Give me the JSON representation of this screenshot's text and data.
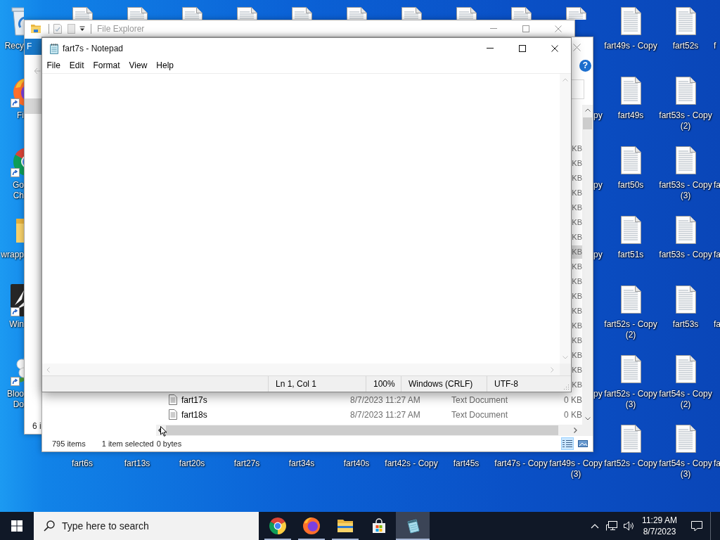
{
  "desktop": {
    "left_column": [
      {
        "kind": "recycle-bin",
        "shortcut": false,
        "label": "Recy"
      },
      {
        "kind": "firefox",
        "shortcut": true,
        "label": "Fi"
      },
      {
        "kind": "chrome",
        "shortcut": true,
        "label": "Go Ch"
      },
      {
        "kind": "folder",
        "shortcut": false,
        "label": "wrapp"
      },
      {
        "kind": "dark-app",
        "shortcut": true,
        "label": "Win"
      },
      {
        "kind": "flower",
        "shortcut": true,
        "label": "Bloo Do"
      }
    ],
    "top_row": [
      {
        "kind": "text-file"
      },
      {
        "kind": "text-file"
      },
      {
        "kind": "text-file"
      },
      {
        "kind": "text-file"
      },
      {
        "kind": "text-file"
      },
      {
        "kind": "text-file"
      },
      {
        "kind": "text-file"
      },
      {
        "kind": "text-file"
      },
      {
        "kind": "text-file"
      },
      {
        "kind": "text-file"
      }
    ],
    "bottom_row": [
      "fart6s",
      "fart13s",
      "fart20s",
      "fart27s",
      "fart34s",
      "fart40s",
      "fart42s - Copy",
      "fart45s",
      "fart47s - Copy",
      "fart49s - Copy (3)"
    ],
    "right_rows": [
      {
        "columns": [
          {
            "kind": "text-file",
            "label": "fart49s - Copy"
          },
          {
            "kind": "text-file",
            "label": "fart52s"
          }
        ],
        "partial_right": "f"
      },
      {
        "partial_left": "py",
        "columns": [
          {
            "kind": "text-file",
            "label": "fart49s"
          },
          {
            "kind": "text-file",
            "label": "fart53s - Copy (2)"
          }
        ]
      },
      {
        "partial_left": "py",
        "columns": [
          {
            "kind": "text-file",
            "label": "fart50s"
          },
          {
            "kind": "text-file",
            "label": "fart53s - Copy (3)"
          }
        ],
        "partial_right": "fa"
      },
      {
        "partial_left": "py",
        "columns": [
          {
            "kind": "text-file",
            "label": "fart51s"
          },
          {
            "kind": "text-file",
            "label": "fart53s - Copy"
          }
        ],
        "partial_right": "fa"
      },
      {
        "columns": [
          {
            "kind": "text-file",
            "label": "fart52s - Copy (2)"
          },
          {
            "kind": "text-file",
            "label": "fart53s"
          }
        ],
        "partial_right": "fa"
      },
      {
        "partial_left": "py",
        "columns": [
          {
            "kind": "text-file",
            "label": "fart52s - Copy (3)"
          },
          {
            "kind": "text-file",
            "label": "fart54s - Copy (2)"
          }
        ]
      },
      {
        "columns": [
          {
            "kind": "text-file",
            "label": "fart52s - Copy"
          },
          {
            "kind": "text-file",
            "label": "fart54s - Copy (3)"
          }
        ],
        "partial_right": "fa"
      }
    ]
  },
  "explorer_behind": {
    "title": "File Explorer",
    "active": false,
    "file_tab": "F",
    "nav_items": [
      {
        "selected": true
      }
    ],
    "status": "6 i"
  },
  "explorer": {
    "active": false,
    "help": "?",
    "rows": [
      {
        "size": "KB",
        "selected": false
      },
      {
        "size": "KB",
        "selected": false
      },
      {
        "size": "KB",
        "selected": false
      },
      {
        "size": "KB",
        "selected": false
      },
      {
        "size": "KB",
        "selected": false
      },
      {
        "size": "KB",
        "selected": false
      },
      {
        "size": "KB",
        "selected": false
      },
      {
        "size": "KB",
        "selected": true
      },
      {
        "size": "KB",
        "selected": false
      },
      {
        "size": "KB",
        "selected": false
      },
      {
        "size": "KB",
        "selected": false
      },
      {
        "size": "KB",
        "selected": false
      },
      {
        "size": "KB",
        "selected": false
      },
      {
        "size": "KB",
        "selected": false
      },
      {
        "size": "KB",
        "selected": false
      },
      {
        "size": "KB",
        "selected": false
      },
      {
        "size": "KB",
        "selected": false
      },
      {
        "name": "fart17s",
        "date": "8/7/2023 11:27 AM",
        "type": "Text Document",
        "size": "0 KB",
        "selected": false
      },
      {
        "name": "fart18s",
        "date": "8/7/2023 11:27 AM",
        "type": "Text Document",
        "size": "0 KB",
        "selected": false
      }
    ],
    "status": {
      "items": "795 items",
      "selection": "1 item selected",
      "size": "0 bytes"
    },
    "views": [
      {
        "kind": "details",
        "selected": true
      },
      {
        "kind": "large-icons",
        "selected": false
      }
    ]
  },
  "notepad": {
    "title": "fart7s - Notepad",
    "active": true,
    "menu": [
      "File",
      "Edit",
      "Format",
      "View",
      "Help"
    ],
    "status": [
      "Ln 1, Col 1",
      "100%",
      "Windows (CRLF)",
      "UTF-8"
    ]
  },
  "taskbar": {
    "search": {
      "placeholder": "Type here to search"
    },
    "apps": [
      {
        "kind": "chrome",
        "running": true,
        "selected": false
      },
      {
        "kind": "firefox",
        "running": true,
        "selected": false
      },
      {
        "kind": "file-explorer",
        "running": true,
        "selected": false
      },
      {
        "kind": "store",
        "running": false,
        "selected": false
      },
      {
        "kind": "notepad",
        "running": true,
        "selected": true
      }
    ],
    "clock": {
      "time": "11:29 AM",
      "date": "8/7/2023"
    }
  }
}
